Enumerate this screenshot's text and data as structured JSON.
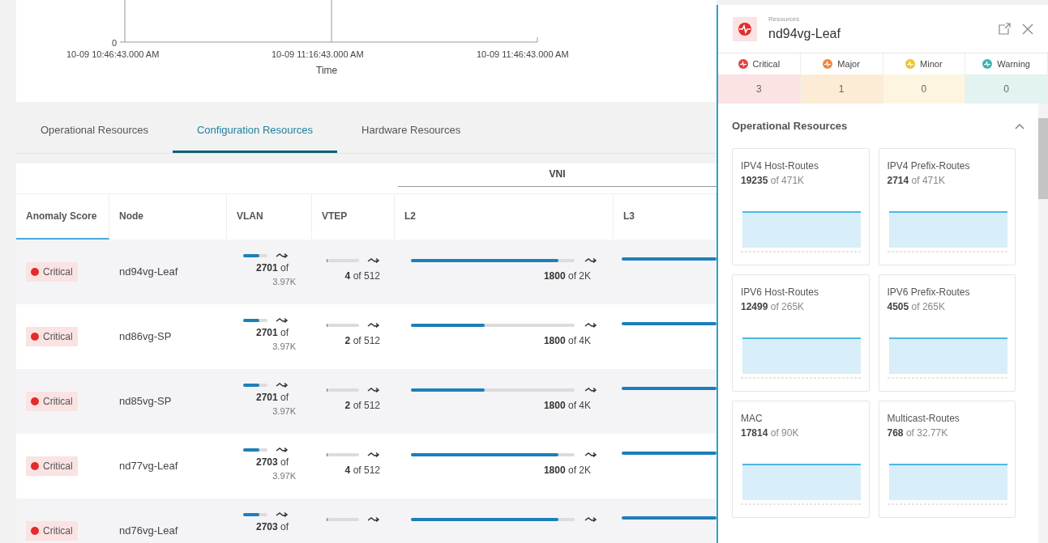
{
  "time_chart": {
    "y_tick": "0",
    "x_ticks": [
      "10-09 10:46:43.000 AM",
      "10-09 11:16:43.000 AM",
      "10-09 11:46:43.000 AM"
    ],
    "xlabel": "Time"
  },
  "tabs": [
    {
      "label": "Operational Resources",
      "selected": false
    },
    {
      "label": "Configuration Resources",
      "selected": true
    },
    {
      "label": "Hardware Resources",
      "selected": false
    }
  ],
  "table": {
    "group_header": "VNI",
    "columns": [
      {
        "label": "Anomaly Score",
        "sorted": true
      },
      {
        "label": "Node",
        "sorted": false
      },
      {
        "label": "VLAN",
        "sorted": false
      },
      {
        "label": "VTEP",
        "sorted": false
      },
      {
        "label": "L2",
        "sorted": false
      },
      {
        "label": "L3",
        "sorted": false
      }
    ],
    "rows": [
      {
        "score": "Critical",
        "node": "nd94vg-Leaf",
        "vlan": {
          "used": "2701",
          "of": "of",
          "total": "3.97K",
          "level": 0.68
        },
        "vtep": {
          "used": "4",
          "rest": "of 512",
          "level": 0.02
        },
        "l2": {
          "used": "1800",
          "rest": "of 2K",
          "level": 0.9
        }
      },
      {
        "score": "Critical",
        "node": "nd86vg-SP",
        "vlan": {
          "used": "2701",
          "of": "of",
          "total": "3.97K",
          "level": 0.68
        },
        "vtep": {
          "used": "2",
          "rest": "of 512",
          "level": 0.02
        },
        "l2": {
          "used": "1800",
          "rest": "of 4K",
          "level": 0.45
        }
      },
      {
        "score": "Critical",
        "node": "nd85vg-SP",
        "vlan": {
          "used": "2701",
          "of": "of",
          "total": "3.97K",
          "level": 0.68
        },
        "vtep": {
          "used": "2",
          "rest": "of 512",
          "level": 0.02
        },
        "l2": {
          "used": "1800",
          "rest": "of 4K",
          "level": 0.45
        }
      },
      {
        "score": "Critical",
        "node": "nd77vg-Leaf",
        "vlan": {
          "used": "2703",
          "of": "of",
          "total": "3.97K",
          "level": 0.68
        },
        "vtep": {
          "used": "4",
          "rest": "of 512",
          "level": 0.02
        },
        "l2": {
          "used": "1800",
          "rest": "of 2K",
          "level": 0.9
        }
      },
      {
        "score": "Critical",
        "node": "nd76vg-Leaf",
        "vlan": {
          "used": "2703",
          "of": "of",
          "level": 0.68
        },
        "vtep": {
          "level": 0.02
        },
        "l2": {
          "level": 0.9
        }
      }
    ]
  },
  "panel": {
    "subtitle": "Resources",
    "title": "nd94vg-Leaf",
    "severities": [
      {
        "label": "Critical",
        "count": "3",
        "color": "#e8403f"
      },
      {
        "label": "Major",
        "count": "1",
        "color": "#f08a3c"
      },
      {
        "label": "Minor",
        "count": "0",
        "color": "#f2c230"
      },
      {
        "label": "Warning",
        "count": "0",
        "color": "#3fb5b5"
      }
    ],
    "section": {
      "title": "Operational Resources",
      "expanded": true
    },
    "cards": [
      {
        "title": "IPV4 Host-Routes",
        "used": "19235",
        "rest": "of 471K"
      },
      {
        "title": "IPV4 Prefix-Routes",
        "used": "2714",
        "rest": "of 471K"
      },
      {
        "title": "IPV6 Host-Routes",
        "used": "12499",
        "rest": "of 265K"
      },
      {
        "title": "IPV6 Prefix-Routes",
        "used": "4505",
        "rest": "of 265K"
      },
      {
        "title": "MAC",
        "used": "17814",
        "rest": "of 90K"
      },
      {
        "title": "Multicast-Routes",
        "used": "768",
        "rest": "of 32.77K"
      }
    ]
  }
}
